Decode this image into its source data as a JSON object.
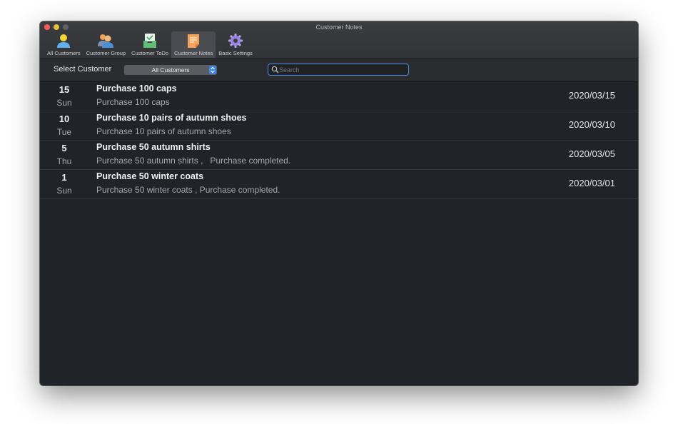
{
  "window": {
    "title": "Customer Notes"
  },
  "toolbar": {
    "items": [
      {
        "label": "All Customers",
        "icon": "person-icon",
        "active": false
      },
      {
        "label": "Customer Group",
        "icon": "group-icon",
        "active": false
      },
      {
        "label": "Customer ToDo",
        "icon": "todo-inbox-icon",
        "active": false
      },
      {
        "label": "Customer Notes",
        "icon": "notes-icon",
        "active": true
      },
      {
        "label": "Basic Settings",
        "icon": "gear-icon",
        "active": false
      }
    ]
  },
  "filter": {
    "label": "Select Customer",
    "selected": "All Customers",
    "search_placeholder": "Search",
    "search_value": ""
  },
  "notes": [
    {
      "day": "15",
      "weekday": "Sun",
      "title": "Purchase 100 caps",
      "desc": "Purchase 100 caps",
      "date": "2020/03/15"
    },
    {
      "day": "10",
      "weekday": "Tue",
      "title": "Purchase 10 pairs of autumn shoes",
      "desc": "Purchase 10 pairs of autumn shoes",
      "date": "2020/03/10"
    },
    {
      "day": "5",
      "weekday": "Thu",
      "title": "Purchase 50 autumn shirts",
      "desc": "Purchase 50 autumn shirts ,   Purchase completed.",
      "date": "2020/03/05"
    },
    {
      "day": "1",
      "weekday": "Sun",
      "title": "Purchase 50 winter coats",
      "desc": "Purchase 50 winter coats , Purchase completed.",
      "date": "2020/03/01"
    }
  ],
  "colors": {
    "accent": "#3b82e6",
    "window_bg": "#202328",
    "close": "#fc5b57",
    "minimize": "#e5bf3c"
  }
}
